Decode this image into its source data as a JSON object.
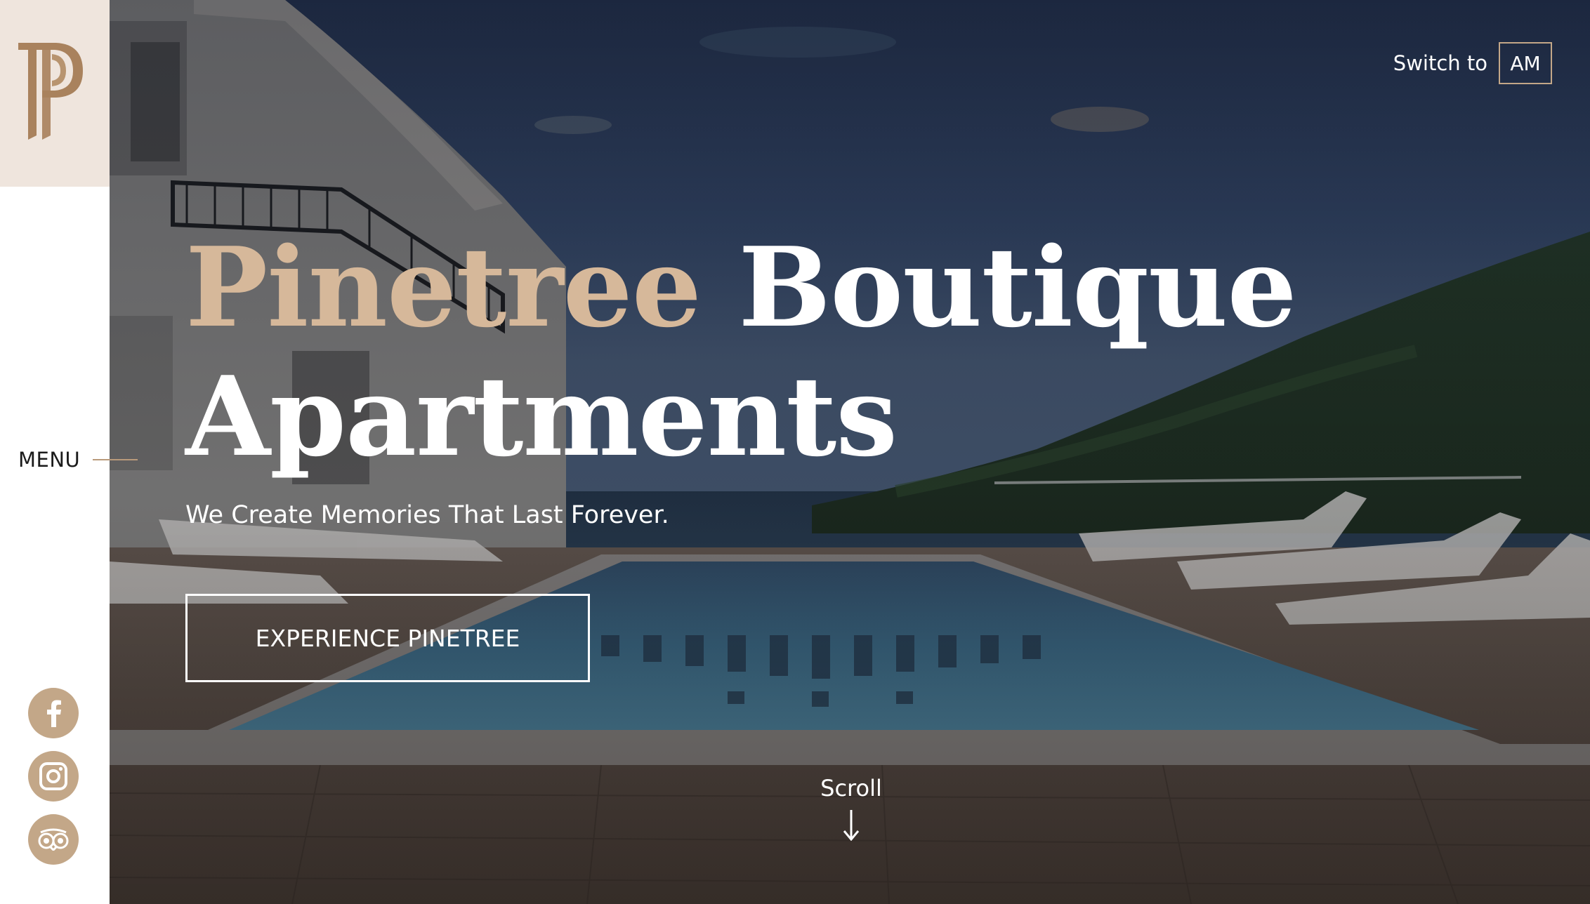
{
  "sidebar": {
    "logo_letters": "PP",
    "menu_label": "MENU",
    "social": [
      {
        "icon": "facebook-icon"
      },
      {
        "icon": "instagram-icon"
      },
      {
        "icon": "tripadvisor-icon"
      }
    ]
  },
  "header": {
    "switch_label": "Switch to",
    "language_code": "AM"
  },
  "hero": {
    "title_accent": "Pinetree",
    "title_rest_line1": "Boutique",
    "title_line2": "Apartments",
    "tagline": "We Create Memories That Last Forever.",
    "cta_label": "EXPERIENCE PINETREE",
    "scroll_label": "Scroll"
  },
  "colors": {
    "accent": "#c3a788",
    "title_accent": "#d6b89a",
    "logo_background": "#efe5dd",
    "logo_mark": "#a9825d",
    "text_dark": "#1b1b1b"
  }
}
